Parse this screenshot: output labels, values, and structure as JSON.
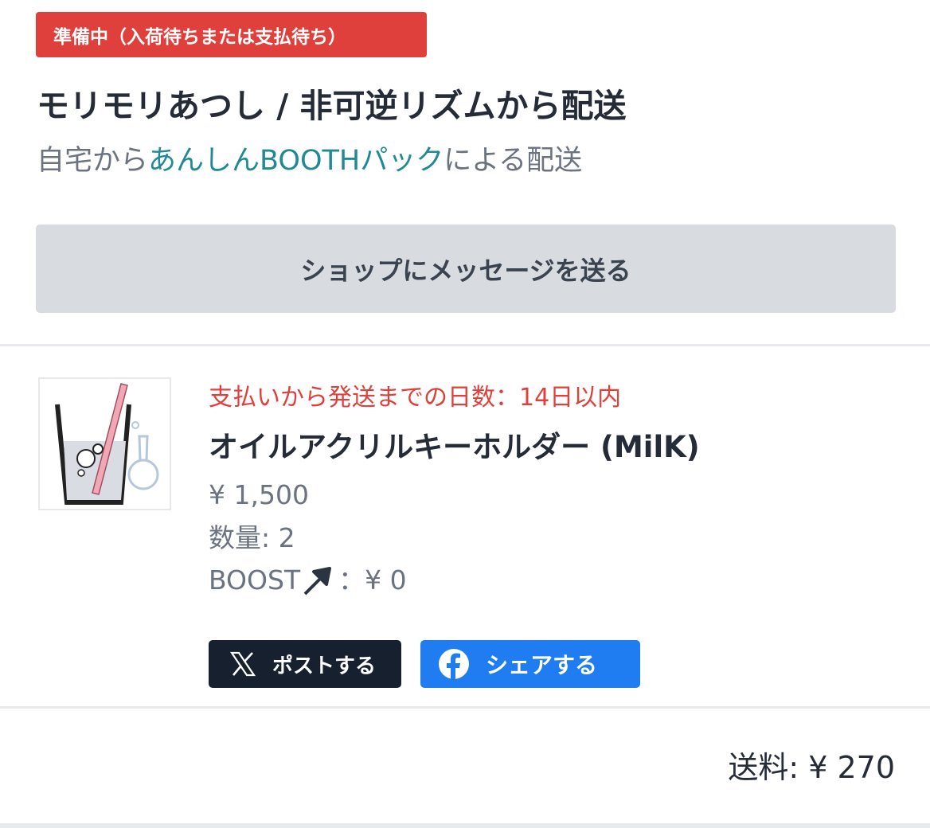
{
  "status_badge": "準備中（入荷待ちまたは支払待ち）",
  "shop": {
    "title": "モリモリあつし / 非可逆リズムから配送",
    "shipping_prefix": "自宅から",
    "shipping_link": "あんしんBOOTHパック",
    "shipping_suffix": "による配送"
  },
  "message_button": "ショップにメッセージを送る",
  "item": {
    "lead_time": "支払いから発送までの日数：14日以内",
    "name": "オイルアクリルキーホルダー (MilK)",
    "price": "¥ 1,500",
    "quantity": "数量:  2",
    "boost_label": "BOOST",
    "boost_value": "：¥ 0",
    "thumbnail_icon": "acrylic-keychain-glass-image"
  },
  "share": {
    "x_label": "ポストする",
    "facebook_label": "シェアする"
  },
  "shipping_fee": "送料:  ¥ 270",
  "colors": {
    "badge": "#e0403b",
    "link": "#1f8a94",
    "x_button": "#17202e",
    "facebook_button": "#1f7df1"
  }
}
